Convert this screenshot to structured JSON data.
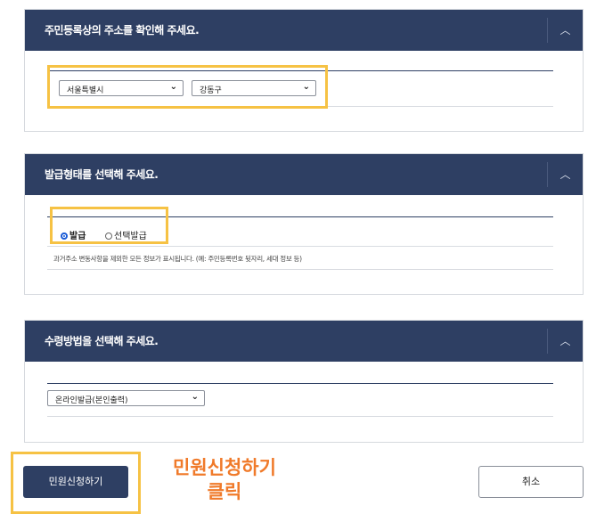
{
  "section_address": {
    "title": "주민등록상의 주소를 확인해 주세요.",
    "toggle_icon": "chevron-up",
    "city_value": "서울특별시",
    "district_value": "강동구"
  },
  "section_issue_type": {
    "title": "발급형태를 선택해 주세요.",
    "toggle_icon": "chevron-up",
    "option_issue": "발급",
    "option_selective": "선택발급",
    "selected": "발급",
    "note": "과거주소 변동사항을 제외한 모든 정보가 표시됩니다. (예: 주민등록번호 뒷자리, 세대 정보 등)"
  },
  "section_receive": {
    "title": "수령방법을 선택해 주세요.",
    "toggle_icon": "chevron-up",
    "method_value": "온라인발급(본인출력)"
  },
  "actions": {
    "apply_label": "민원신청하기",
    "cancel_label": "취소"
  },
  "annotation": {
    "line1": "민원신청하기",
    "line2": "클릭",
    "color": "#f07a2a"
  },
  "colors": {
    "header": "#2e3f63",
    "highlight": "#f6c244"
  }
}
